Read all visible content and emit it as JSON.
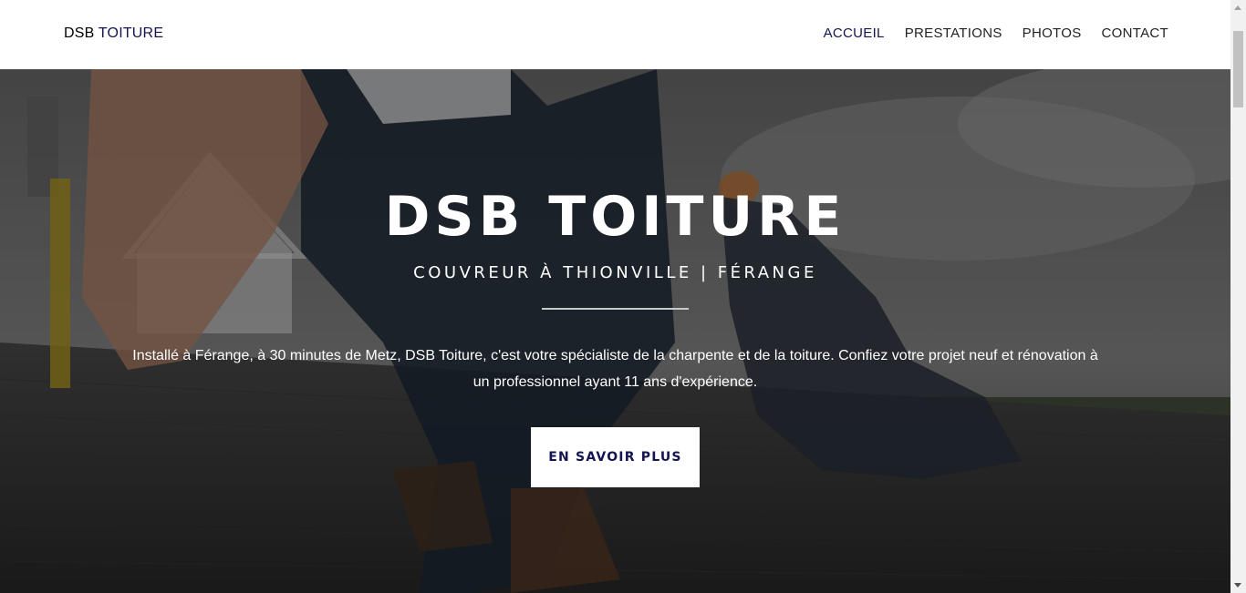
{
  "header": {
    "brand_prefix": "DSB",
    "brand_accent": "TOITURE",
    "nav": [
      {
        "label": "ACCUEIL",
        "active": true
      },
      {
        "label": "PRESTATIONS",
        "active": false
      },
      {
        "label": "PHOTOS",
        "active": false
      },
      {
        "label": "CONTACT",
        "active": false
      }
    ]
  },
  "hero": {
    "title": "DSB TOITURE",
    "subtitle": "COUVREUR À THIONVILLE | FÉRANGE",
    "text": "Installé à Férange, à 30 minutes de Metz, DSB Toiture, c'est votre spécialiste de la charpente et de la toiture. Confiez votre projet neuf et rénovation à un professionnel ayant 11 ans d'expérience.",
    "button_label": "EN SAVOIR PLUS"
  },
  "colors": {
    "accent": "#141452",
    "header_bg": "#ffffff",
    "hero_overlay": "#000000"
  }
}
